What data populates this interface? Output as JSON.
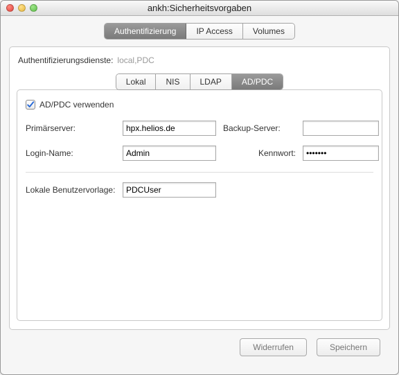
{
  "window": {
    "title": "ankh:Sicherheitsvorgaben"
  },
  "topTabs": {
    "items": [
      "Authentifizierung",
      "IP Access",
      "Volumes"
    ],
    "active": 0
  },
  "authServices": {
    "label": "Authentifizierungsdienste:",
    "value": "local,PDC"
  },
  "innerTabs": {
    "items": [
      "Lokal",
      "NIS",
      "LDAP",
      "AD/PDC"
    ],
    "active": 3
  },
  "adpdc": {
    "useCheckbox": {
      "label": "AD/PDC verwenden",
      "checked": true
    },
    "primaryServer": {
      "label": "Primärserver:",
      "value": "hpx.helios.de"
    },
    "backupServer": {
      "label": "Backup-Server:",
      "value": ""
    },
    "loginName": {
      "label": "Login-Name:",
      "value": "Admin"
    },
    "password": {
      "label": "Kennwort:",
      "value": "•••••••"
    },
    "userTemplate": {
      "label": "Lokale Benutzervorlage:",
      "value": "PDCUser"
    }
  },
  "buttons": {
    "revert": "Widerrufen",
    "save": "Speichern"
  }
}
